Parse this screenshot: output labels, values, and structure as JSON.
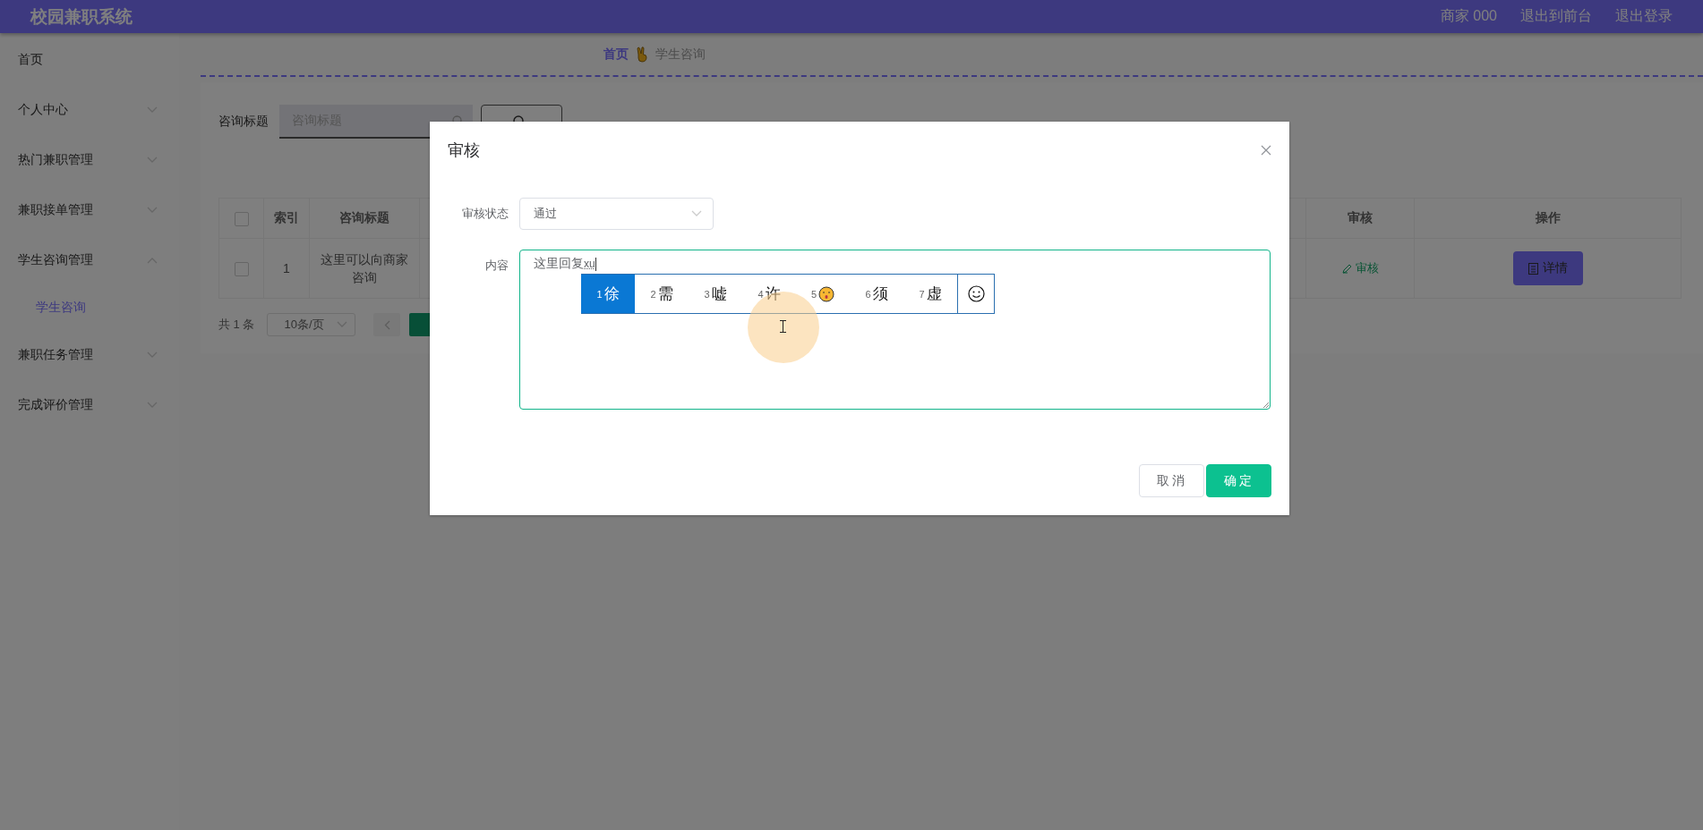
{
  "header": {
    "title": "校园兼职系统",
    "links": [
      "商家 000",
      "退出到前台",
      "退出登录"
    ]
  },
  "sidebar": {
    "items": [
      {
        "label": "首页"
      },
      {
        "label": "个人中心",
        "expanded": false
      },
      {
        "label": "热门兼职管理",
        "expanded": false
      },
      {
        "label": "兼职接单管理",
        "expanded": false
      },
      {
        "label": "学生咨询管理",
        "expanded": true,
        "children": [
          {
            "label": "学生咨询",
            "selected": true
          }
        ]
      },
      {
        "label": "兼职任务管理",
        "expanded": false
      },
      {
        "label": "完成评价管理",
        "expanded": false
      }
    ]
  },
  "breadcrumb": [
    "首页",
    "学生咨询"
  ],
  "search": {
    "label": "咨询标题",
    "placeholder": "咨询标题"
  },
  "table": {
    "all_checked": false,
    "columns": [
      "索引",
      "咨询标题",
      "审核",
      "操作"
    ],
    "rows": [
      {
        "checked": false,
        "index": "1",
        "title": "这里可以向商家咨询",
        "review": "审核",
        "action": "详情"
      }
    ]
  },
  "pagination": {
    "total": "共 1 条",
    "page_size": "10条/页"
  },
  "dialog": {
    "title": "审核",
    "fields": [
      {
        "kind": "select",
        "label": "审核状态",
        "value": "通过"
      },
      {
        "kind": "textarea",
        "label": "内容",
        "value": "这里回复",
        "composition": "xu"
      }
    ],
    "buttons": [
      {
        "label": "取消",
        "kind": "default"
      },
      {
        "label": "确定",
        "kind": "primary"
      }
    ]
  },
  "ime": {
    "candidates": [
      {
        "number": "1",
        "kind": "char",
        "text": "徐",
        "selected": true
      },
      {
        "number": "2",
        "kind": "char",
        "text": "需",
        "selected": false
      },
      {
        "number": "3",
        "kind": "char",
        "text": "嘘",
        "selected": false
      },
      {
        "number": "4",
        "kind": "char",
        "text": "许",
        "selected": false
      },
      {
        "number": "5",
        "kind": "emoji",
        "selected": false
      },
      {
        "number": "6",
        "kind": "char",
        "text": "须",
        "selected": false
      },
      {
        "number": "7",
        "kind": "char",
        "text": "虚",
        "selected": false
      }
    ]
  }
}
